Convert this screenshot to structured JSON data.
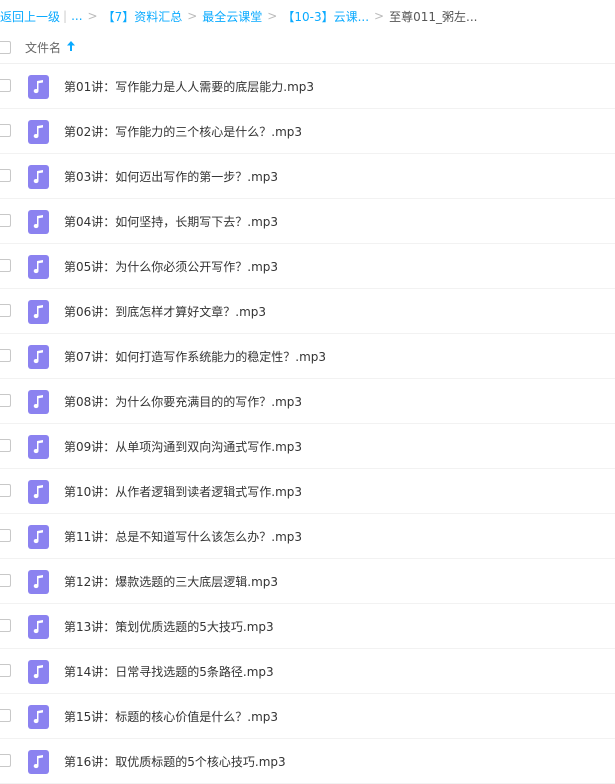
{
  "breadcrumb": {
    "back": "返回上一级",
    "ellipsis": "...",
    "sep": ">",
    "items": [
      "【7】资料汇总",
      "最全云课堂",
      "【10-3】云课..."
    ],
    "current": "至尊011_粥左..."
  },
  "header": {
    "column_name": "文件名",
    "sort_icon": "arrow-up-icon"
  },
  "files": [
    "第01讲：写作能力是人人需要的底层能力.mp3",
    "第02讲：写作能力的三个核心是什么？.mp3",
    "第03讲：如何迈出写作的第一步？.mp3",
    "第04讲：如何坚持，长期写下去？.mp3",
    "第05讲：为什么你必须公开写作？.mp3",
    "第06讲：到底怎样才算好文章？.mp3",
    "第07讲：如何打造写作系统能力的稳定性？.mp3",
    "第08讲：为什么你要充满目的的写作？.mp3",
    "第09讲：从单项沟通到双向沟通式写作.mp3",
    "第10讲：从作者逻辑到读者逻辑式写作.mp3",
    "第11讲：总是不知道写什么该怎么办？.mp3",
    "第12讲：爆款选题的三大底层逻辑.mp3",
    "第13讲：策划优质选题的5大技巧.mp3",
    "第14讲：日常寻找选题的5条路径.mp3",
    "第15讲：标题的核心价值是什么？.mp3",
    "第16讲：取优质标题的5个核心技巧.mp3"
  ],
  "colors": {
    "link": "#09aaff",
    "music_icon_bg": "#8b82f0"
  }
}
